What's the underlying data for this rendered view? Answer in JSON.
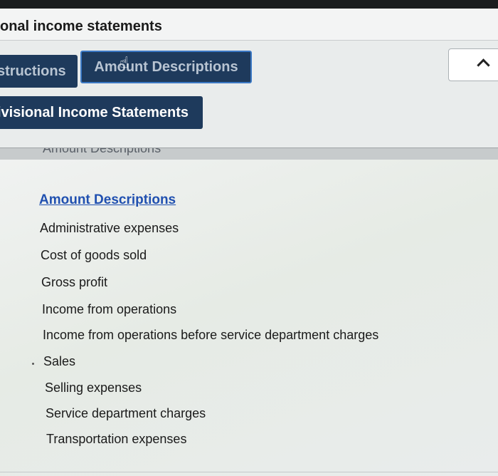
{
  "header": {
    "title": "onal income statements"
  },
  "tabs": {
    "instructions_label": "structions",
    "amount_label": "Amount Descriptions",
    "divisional_label": "ivisional Income Statements"
  },
  "panel": {
    "header_label": "Amount Descriptions",
    "heading": "Amount Descriptions",
    "items": [
      "Administrative expenses",
      "Cost of goods sold",
      "Gross profit",
      "Income from operations",
      "Income from operations before service department charges",
      "Sales",
      "Selling expenses",
      "Service department charges",
      "Transportation expenses"
    ]
  }
}
